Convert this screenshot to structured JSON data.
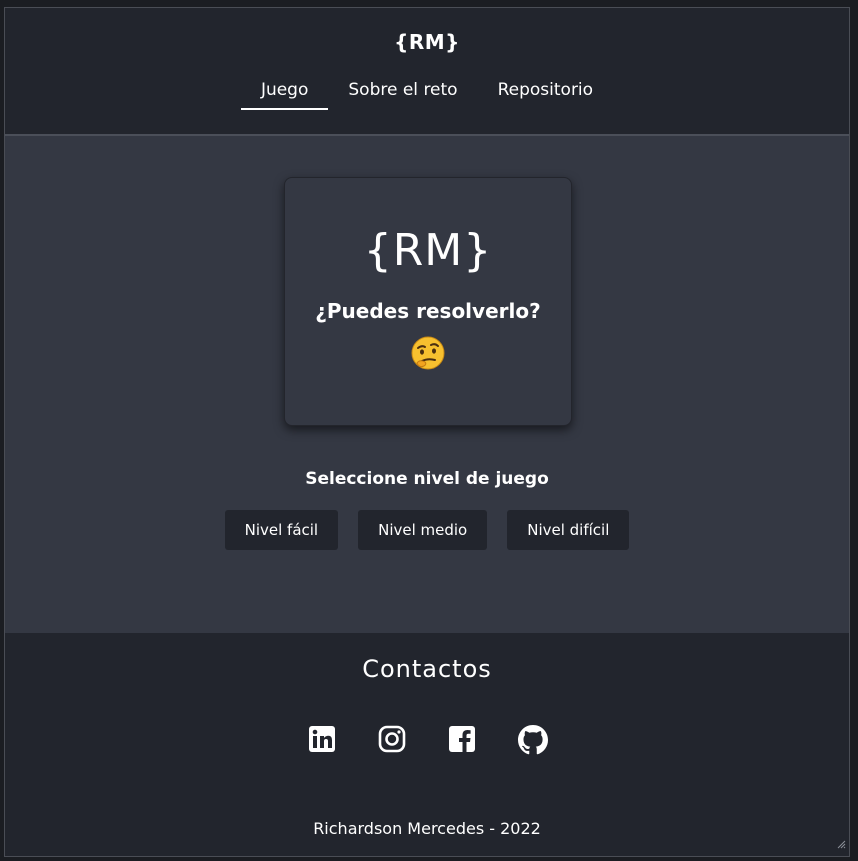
{
  "header": {
    "brand": "{RM}",
    "tabs": [
      {
        "label": "Juego",
        "active": true
      },
      {
        "label": "Sobre el reto",
        "active": false
      },
      {
        "label": "Repositorio",
        "active": false
      }
    ]
  },
  "card": {
    "title": "{RM}",
    "question": "¿Puedes resolverlo?",
    "emoji": "face-with-raised-eyebrow-icon"
  },
  "levels": {
    "title": "Seleccione nivel de juego",
    "buttons": [
      "Nivel fácil",
      "Nivel medio",
      "Nivel difícil"
    ]
  },
  "footer": {
    "title": "Contactos",
    "socials": [
      "linkedin-icon",
      "instagram-icon",
      "facebook-icon",
      "github-icon"
    ],
    "copyright": "Richardson Mercedes - 2022"
  },
  "colors": {
    "page_bg": "#22252d",
    "main_bg": "#343843",
    "button_bg": "#22252d",
    "text": "#ffffff"
  }
}
